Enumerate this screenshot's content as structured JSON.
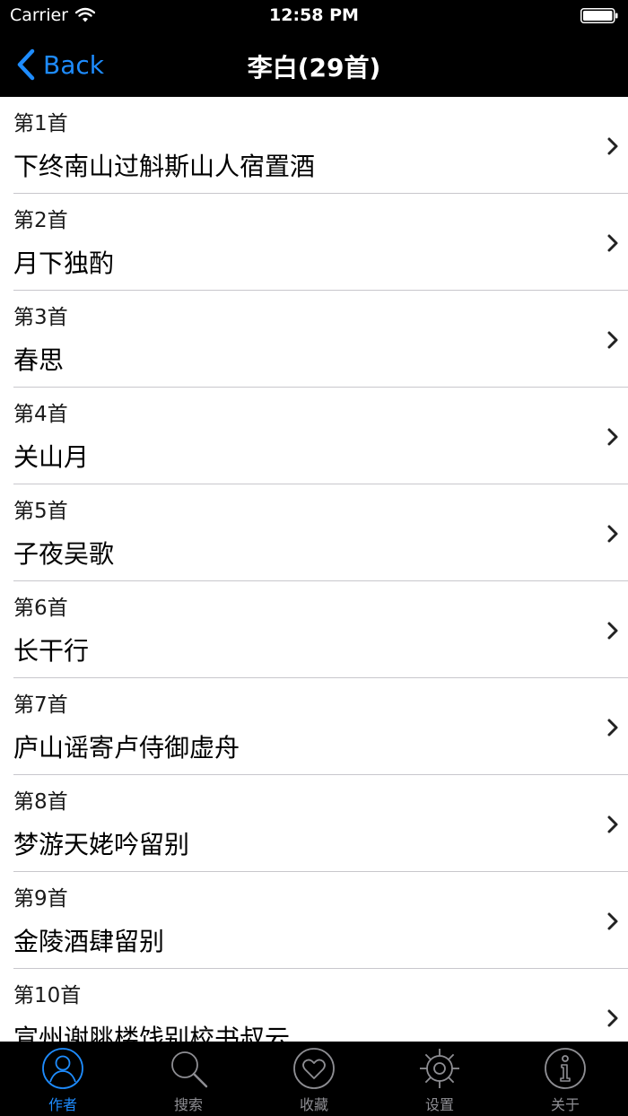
{
  "status_bar": {
    "carrier": "Carrier",
    "time": "12:58 PM"
  },
  "nav": {
    "back_label": "Back",
    "title": "李白(29首)"
  },
  "poems": [
    {
      "index": "第1首",
      "title": "下终南山过斛斯山人宿置酒"
    },
    {
      "index": "第2首",
      "title": "月下独酌"
    },
    {
      "index": "第3首",
      "title": "春思"
    },
    {
      "index": "第4首",
      "title": "关山月"
    },
    {
      "index": "第5首",
      "title": "子夜吴歌"
    },
    {
      "index": "第6首",
      "title": "长干行"
    },
    {
      "index": "第7首",
      "title": "庐山谣寄卢侍御虚舟"
    },
    {
      "index": "第8首",
      "title": "梦游天姥吟留别"
    },
    {
      "index": "第9首",
      "title": "金陵酒肆留别"
    },
    {
      "index": "第10首",
      "title": "宣州谢脁楼饯别校书叔云"
    }
  ],
  "tabs": [
    {
      "label": "作者",
      "icon": "person-icon",
      "active": true
    },
    {
      "label": "搜索",
      "icon": "search-icon",
      "active": false
    },
    {
      "label": "收藏",
      "icon": "heart-icon",
      "active": false
    },
    {
      "label": "设置",
      "icon": "gear-icon",
      "active": false
    },
    {
      "label": "关于",
      "icon": "info-icon",
      "active": false
    }
  ],
  "colors": {
    "accent": "#1e8cff",
    "bar_background": "#000000",
    "inactive_tab": "#8e8e93",
    "separator": "#c8c7cc"
  }
}
